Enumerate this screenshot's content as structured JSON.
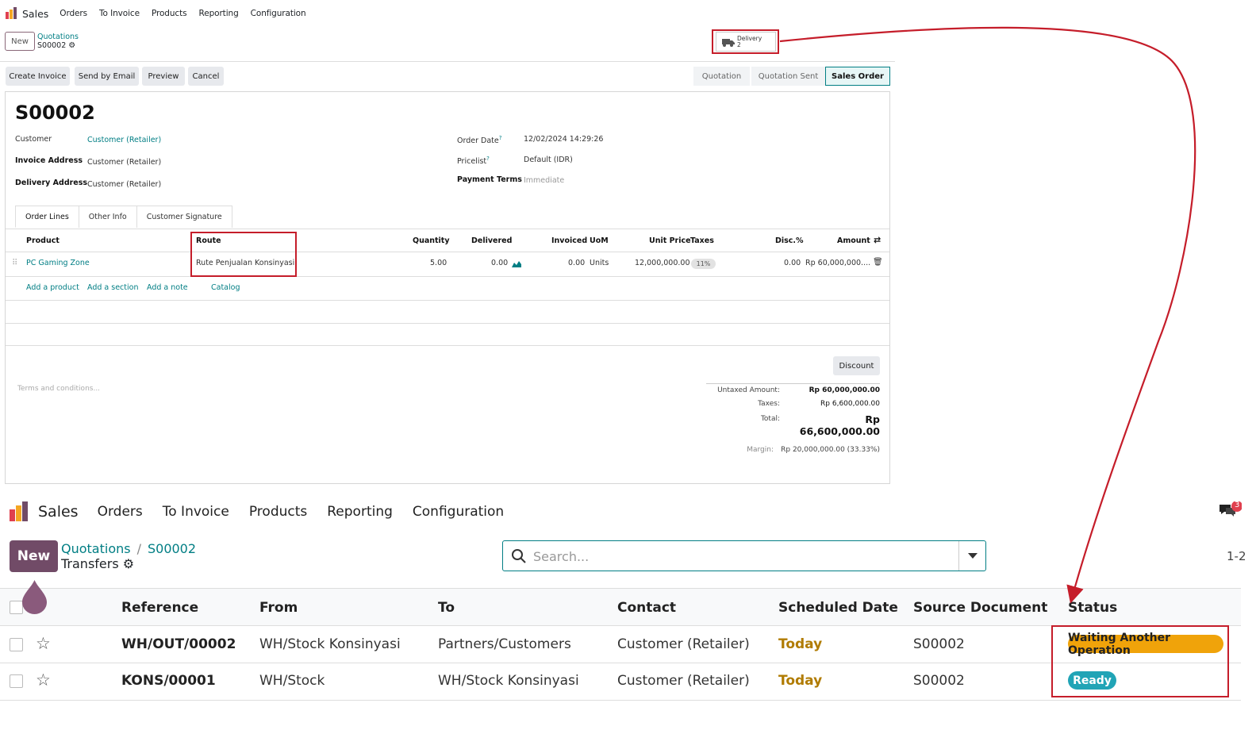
{
  "top": {
    "app_name": "Sales",
    "menu": [
      "Orders",
      "To Invoice",
      "Products",
      "Reporting",
      "Configuration"
    ],
    "new_label": "New",
    "breadcrumb_parent": "Quotations",
    "breadcrumb_current": "S00002",
    "delivery_label": "Delivery",
    "delivery_count": "2",
    "actions": [
      "Create Invoice",
      "Send by Email",
      "Preview",
      "Cancel"
    ],
    "stages": [
      "Quotation",
      "Quotation Sent",
      "Sales Order"
    ],
    "active_stage": "Sales Order",
    "order_name": "S00002",
    "fields": {
      "customer_label": "Customer",
      "customer_value": "Customer (Retailer)",
      "invoice_address_label": "Invoice Address",
      "invoice_address_value": "Customer (Retailer)",
      "delivery_address_label": "Delivery Address",
      "delivery_address_value": "Customer (Retailer)",
      "order_date_label": "Order Date",
      "order_date_value": "12/02/2024 14:29:26",
      "pricelist_label": "Pricelist",
      "pricelist_value": "Default (IDR)",
      "payment_terms_label": "Payment Terms",
      "payment_terms_value": "Immediate",
      "help_mark": "?"
    },
    "tabs": [
      "Order Lines",
      "Other Info",
      "Customer Signature"
    ],
    "columns": [
      "Product",
      "Route",
      "Quantity",
      "Delivered",
      "Invoiced",
      "UoM",
      "Unit Price",
      "Taxes",
      "Disc.%",
      "Amount"
    ],
    "line": {
      "product": "PC Gaming Zone",
      "route": "Rute Penjualan Konsinyasi",
      "quantity": "5.00",
      "delivered": "0.00",
      "invoiced": "0.00",
      "uom": "Units",
      "unit_price": "12,000,000.00",
      "tax": "11%",
      "discount": "0.00",
      "amount": "Rp 60,000,000...."
    },
    "add_links": [
      "Add a product",
      "Add a section",
      "Add a note",
      "Catalog"
    ],
    "discount_button": "Discount",
    "terms_placeholder": "Terms and conditions...",
    "totals": {
      "untaxed_label": "Untaxed Amount:",
      "untaxed_value": "Rp 60,000,000.00",
      "taxes_label": "Taxes:",
      "taxes_value": "Rp 6,600,000.00",
      "total_label": "Total:",
      "total_value": "Rp 66,600,000.00",
      "margin_label": "Margin:",
      "margin_value": "Rp 20,000,000.00 (33.33%)"
    }
  },
  "bottom": {
    "app_name": "Sales",
    "menu": [
      "Orders",
      "To Invoice",
      "Products",
      "Reporting",
      "Configuration"
    ],
    "chat_badge": "3",
    "new_label": "New",
    "breadcrumb_root": "Quotations",
    "breadcrumb_order": "S00002",
    "page_title": "Transfers",
    "search_placeholder": "Search...",
    "pager": "1-2",
    "columns": [
      "Reference",
      "From",
      "To",
      "Contact",
      "Scheduled Date",
      "Source Document",
      "Status"
    ],
    "rows": [
      {
        "reference": "WH/OUT/00002",
        "from": "WH/Stock Konsinyasi",
        "to": "Partners/Customers",
        "contact": "Customer (Retailer)",
        "scheduled": "Today",
        "source": "S00002",
        "status": "Waiting Another Operation"
      },
      {
        "reference": "KONS/00001",
        "from": "WH/Stock",
        "to": "WH/Stock Konsinyasi",
        "contact": "Customer (Retailer)",
        "scheduled": "Today",
        "source": "S00002",
        "status": "Ready"
      }
    ]
  },
  "colors": {
    "brand": "#714b67",
    "link": "#017e84",
    "highlight": "#c51d2a",
    "warning": "#f0a30a",
    "ready": "#21a4b6"
  }
}
